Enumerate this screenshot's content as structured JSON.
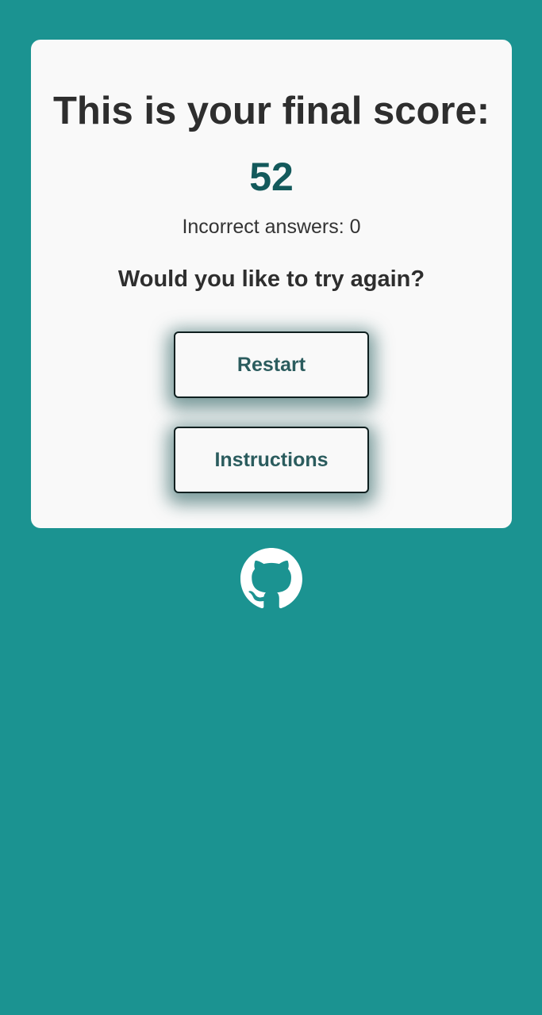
{
  "card": {
    "title": "This is your final score:",
    "score": "52",
    "incorrect_label": "Incorrect answers:",
    "incorrect_count": "0",
    "question": "Would you like to try again?"
  },
  "buttons": {
    "restart_label": "Restart",
    "instructions_label": "Instructions"
  },
  "footer": {
    "icon": "github-icon"
  },
  "colors": {
    "background": "#1b9391",
    "card": "#f9f9f9",
    "score": "#13595b",
    "button_text": "#2b5c5e"
  }
}
